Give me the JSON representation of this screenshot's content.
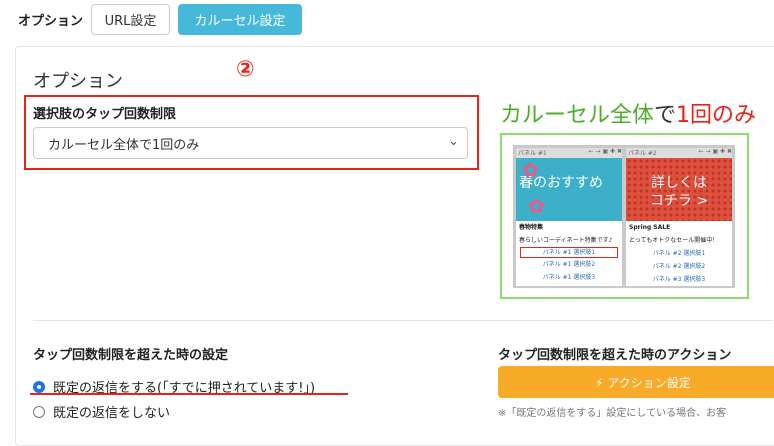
{
  "tabs": {
    "label": "オプション",
    "url": "URL設定",
    "carousel": "カルーセル設定"
  },
  "section": {
    "title": "オプション",
    "marker": "②"
  },
  "select": {
    "label": "選択肢のタップ回数制限",
    "value": "カルーセル全体で1回のみ"
  },
  "preview": {
    "title_green": "カルーセル全体",
    "title_mid": "で",
    "title_red": "1回のみ",
    "panel1": {
      "bar": "パネル #1",
      "image_text": "春のおすすめ",
      "heading": "春物特集",
      "desc": "春らしいコーディネート特集です♪",
      "links": [
        "パネル #1 選択肢1",
        "パネル #1 選択肢2",
        "パネル #1 選択肢3"
      ]
    },
    "panel2": {
      "bar": "パネル #2",
      "image_line1": "詳しくは",
      "image_line2": "コチラ >",
      "heading": "Spring SALE",
      "desc": "とってもオトクなセール開催中！",
      "links": [
        "パネル #2 選択肢1",
        "パネル #2 選択肢2",
        "パネル #3 選択肢3"
      ]
    }
  },
  "limit": {
    "label": "タップ回数制限を超えた時の設定",
    "opt1": "既定の返信をする(「すでに押されています!」)",
    "opt2": "既定の返信をしない"
  },
  "action": {
    "label": "タップ回数制限を超えた時のアクション",
    "button": "⚡ アクション設定",
    "note": "※「既定の返信をする」設定にしている場合、お客"
  },
  "colors": {
    "accent": "#46b8da",
    "red": "#e8231a",
    "orange": "#f7ab28",
    "green": "#4caf2a"
  }
}
